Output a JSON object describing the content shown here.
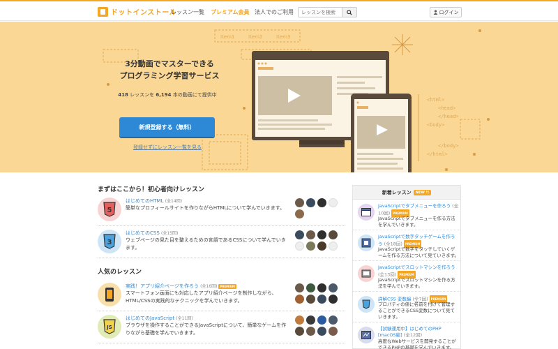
{
  "header": {
    "logo_text": "ドットインストール",
    "nav": [
      "レッスン一覧",
      "プレミアム会員",
      "法人でのご利用"
    ],
    "search_placeholder": "レッスンを検索",
    "login_label": "ログイン"
  },
  "hero": {
    "headline_1": "3分動画でマスターできる",
    "headline_2": "プログラミング学習サービス",
    "lesson_count": "418",
    "stats_mid": " レッスンを ",
    "video_count": "6,194",
    "stats_end": " 本の動画にて提供中",
    "signup_label": "新規登録する（無料）",
    "browse_label": "登録せずにレッスン一覧を見る",
    "art_tabs": [
      "Item1",
      "Item2",
      "Item3"
    ],
    "art_code": [
      "<html>",
      "<head>",
      "</head>",
      "<body>",
      "</body>",
      "</html>"
    ]
  },
  "beginner": {
    "title": "まずはここから！初心者向けレッスン",
    "lessons": [
      {
        "title": "はじめてのHTML",
        "count": "(全14回)",
        "desc": "簡単なプロフィールサイトを作りながらHTMLについて学んでいきます。",
        "icon_text": "5"
      },
      {
        "title": "はじめてのCSS",
        "count": "(全15回)",
        "desc": "ウェブページの見た目を整えるための言語であるCSSについて学んでいきます。",
        "icon_text": "3"
      }
    ]
  },
  "popular": {
    "title": "人気のレッスン",
    "lessons": [
      {
        "title": "実践！アプリ紹介ページを作ろう",
        "count": "(全16回)",
        "premium": "PREMIUM",
        "desc": "スマートフォン画面にも対応したアプリ紹介ページを制作しながら、HTML/CSSの実践的なテクニックを学んでいきます。"
      },
      {
        "title": "はじめてのJavaScript",
        "count": "(全11回)",
        "desc": "ブラウザを操作することができるJavaScriptについて、簡単なゲームを作りながら基礎を学んでいきます。",
        "icon_text": "JS"
      }
    ]
  },
  "sidebar": {
    "title": "新着レッスン",
    "new_badge": "NEW !!",
    "items": [
      {
        "title": "JavaScriptでタブメニューを作ろう",
        "count": "(全10回)",
        "premium": "PREMIUM",
        "desc": "JavaScriptでタブメニューを作る方法を学んでいきます。"
      },
      {
        "title": "JavaScriptで数字タッチゲームを作ろう",
        "count": "(全18回)",
        "premium": "PREMIUM",
        "desc": "JavaScriptで数字をタッチしていくゲームを作る方法について見ていきます。"
      },
      {
        "title": "JavaScriptでスロットマシンを作ろう",
        "count": "(全13回)",
        "premium": "PREMIUM",
        "desc": "JavaScriptでスロットマシンを作る方法を学んでいきます。"
      },
      {
        "title": "詳解CSS 変数編",
        "count": "(全7回)",
        "premium": "PREMIUM",
        "desc": "プロパティの値に名前を付けて管理することができるCSS変数について見ていきます。"
      },
      {
        "title": "【試験運用中】はじめてのPHP [macOS編]",
        "count": "(全12回)",
        "desc": "高度なWebサービスを開発することができるPHPの基礎を学んでいきます。"
      }
    ]
  },
  "colors": {
    "accent": "#f5a623",
    "hero_bg": "#fbd795",
    "link": "#2d88d5",
    "button": "#2d88d5"
  }
}
